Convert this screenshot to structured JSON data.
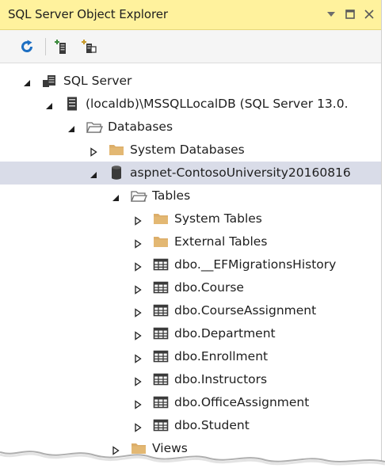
{
  "panel": {
    "title": "SQL Server Object Explorer",
    "dropdown_icon": "dropdown-arrow-icon",
    "maximize_icon": "maximize-icon",
    "close_icon": "close-icon"
  },
  "toolbar": {
    "buttons": [
      {
        "name": "refresh-button",
        "icon": "refresh-icon"
      },
      {
        "name": "add-sql-server-button",
        "icon": "add-server-icon"
      },
      {
        "name": "connect-button",
        "icon": "connect-icon"
      }
    ]
  },
  "tree": {
    "nodes": [
      {
        "label": "SQL Server",
        "depth": 0,
        "expander": "expanded",
        "icon": "sql-server-icon"
      },
      {
        "label": "(localdb)\\MSSQLLocalDB (SQL Server 13.0.",
        "depth": 1,
        "expander": "expanded",
        "icon": "server-icon"
      },
      {
        "label": "Databases",
        "depth": 2,
        "expander": "expanded",
        "icon": "folder-open-icon"
      },
      {
        "label": "System Databases",
        "depth": 3,
        "expander": "collapsed",
        "icon": "folder-icon"
      },
      {
        "label": "aspnet-ContosoUniversity20160816",
        "depth": 3,
        "expander": "expanded",
        "icon": "database-icon",
        "selected": true
      },
      {
        "label": "Tables",
        "depth": 4,
        "expander": "expanded",
        "icon": "folder-open-icon"
      },
      {
        "label": "System Tables",
        "depth": 5,
        "expander": "collapsed",
        "icon": "folder-icon"
      },
      {
        "label": "External Tables",
        "depth": 5,
        "expander": "collapsed",
        "icon": "folder-icon"
      },
      {
        "label": "dbo.__EFMigrationsHistory",
        "depth": 5,
        "expander": "collapsed",
        "icon": "table-icon"
      },
      {
        "label": "dbo.Course",
        "depth": 5,
        "expander": "collapsed",
        "icon": "table-icon"
      },
      {
        "label": "dbo.CourseAssignment",
        "depth": 5,
        "expander": "collapsed",
        "icon": "table-icon"
      },
      {
        "label": "dbo.Department",
        "depth": 5,
        "expander": "collapsed",
        "icon": "table-icon"
      },
      {
        "label": "dbo.Enrollment",
        "depth": 5,
        "expander": "collapsed",
        "icon": "table-icon"
      },
      {
        "label": "dbo.Instructors",
        "depth": 5,
        "expander": "collapsed",
        "icon": "table-icon"
      },
      {
        "label": "dbo.OfficeAssignment",
        "depth": 5,
        "expander": "collapsed",
        "icon": "table-icon"
      },
      {
        "label": "dbo.Student",
        "depth": 5,
        "expander": "collapsed",
        "icon": "table-icon"
      },
      {
        "label": "Views",
        "depth": 4,
        "expander": "collapsed",
        "icon": "folder-icon"
      }
    ]
  },
  "colors": {
    "titlebar": "#fff29d",
    "selection": "#d9dce8",
    "folder": "#dcae6a",
    "refresh_blue": "#1e6fc2"
  }
}
